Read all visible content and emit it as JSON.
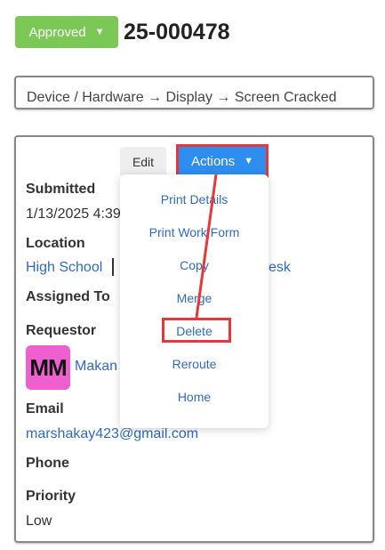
{
  "header": {
    "status_label": "Approved",
    "ticket_id": "25-000478"
  },
  "category": {
    "path": "Device / Hardware → Display → Screen Cracked"
  },
  "toolbar": {
    "edit_label": "Edit",
    "actions_label": "Actions"
  },
  "actions_menu": {
    "items": [
      "Print Details",
      "Print Work Form",
      "Copy",
      "Merge",
      "Delete",
      "Reroute",
      "Home"
    ]
  },
  "details": {
    "submitted_label": "Submitted",
    "submitted_value": "1/13/2025 4:39",
    "location_label": "Location",
    "location_value": "High School",
    "location_tail": "esk",
    "assigned_label": "Assigned To",
    "requestor_label": "Requestor",
    "requestor_initials": "MM",
    "requestor_name": "Makan",
    "email_label": "Email",
    "email_value": "marshakay423@gmail.com",
    "phone_label": "Phone",
    "priority_label": "Priority",
    "priority_value": "Low"
  },
  "colors": {
    "approved_green": "#7cc856",
    "actions_blue": "#2e8ef0",
    "highlight_red": "#e8373a",
    "link_blue": "#2e6bc4",
    "avatar_pink": "#f05fcf"
  }
}
